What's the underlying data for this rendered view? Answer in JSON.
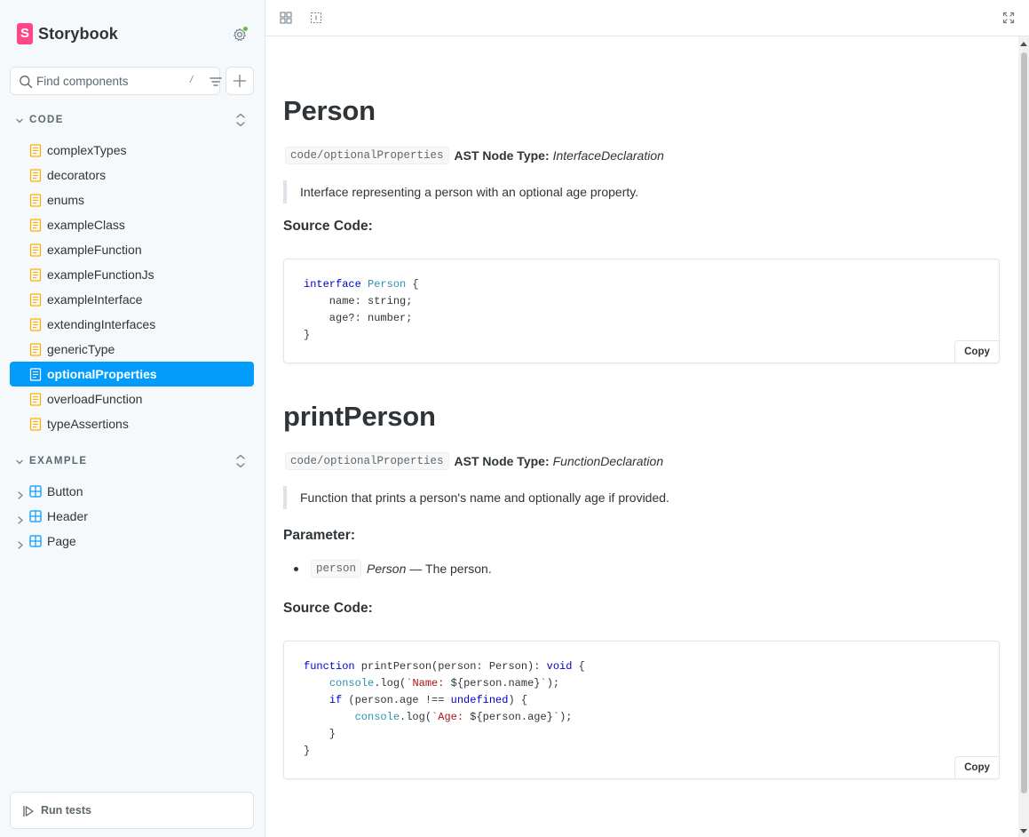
{
  "brand": {
    "name": "Storybook",
    "logo_letter": "S",
    "accent": "#ff4785"
  },
  "search": {
    "placeholder": "Find components",
    "shortcut": "/"
  },
  "sidebar": {
    "groups": [
      {
        "label": "CODE",
        "items": [
          {
            "label": "complexTypes"
          },
          {
            "label": "decorators"
          },
          {
            "label": "enums"
          },
          {
            "label": "exampleClass"
          },
          {
            "label": "exampleFunction"
          },
          {
            "label": "exampleFunctionJs"
          },
          {
            "label": "exampleInterface"
          },
          {
            "label": "extendingInterfaces"
          },
          {
            "label": "genericType"
          },
          {
            "label": "optionalProperties",
            "selected": true
          },
          {
            "label": "overloadFunction"
          },
          {
            "label": "typeAssertions"
          }
        ]
      },
      {
        "label": "EXAMPLE",
        "items": [
          {
            "label": "Button"
          },
          {
            "label": "Header"
          },
          {
            "label": "Page"
          }
        ]
      }
    ],
    "run_tests_label": "Run tests",
    "selected_color": "#029cfd"
  },
  "docs": [
    {
      "title": "Person",
      "path": "code/optionalProperties",
      "ast_label": "AST Node Type:",
      "ast_value": "InterfaceDeclaration",
      "description": "Interface representing a person with an optional age property.",
      "source_heading": "Source Code:",
      "copy_label": "Copy"
    },
    {
      "title": "printPerson",
      "path": "code/optionalProperties",
      "ast_label": "AST Node Type:",
      "ast_value": "FunctionDeclaration",
      "description": "Function that prints a person's name and optionally age if provided.",
      "param_heading": "Parameter:",
      "param": {
        "name": "person",
        "type": "Person",
        "desc": "— The person."
      },
      "source_heading": "Source Code:",
      "copy_label": "Copy"
    }
  ]
}
